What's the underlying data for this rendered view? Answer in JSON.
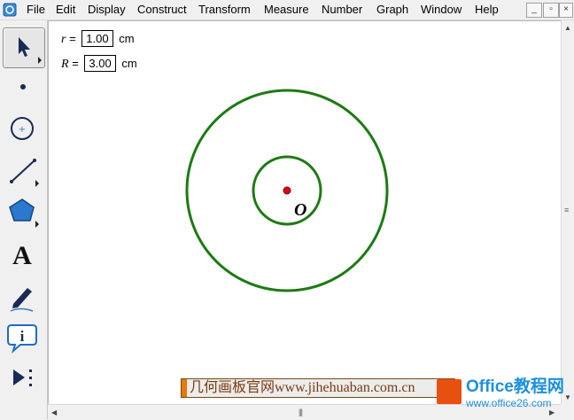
{
  "menubar": {
    "items": [
      {
        "label": "File"
      },
      {
        "label": "Edit"
      },
      {
        "label": "Display"
      },
      {
        "label": "Construct"
      },
      {
        "label": "Transform"
      },
      {
        "label": "Measure"
      },
      {
        "label": "Number"
      },
      {
        "label": "Graph"
      },
      {
        "label": "Window"
      },
      {
        "label": "Help"
      }
    ]
  },
  "window_controls": {
    "minimize": "_",
    "restore": "▫",
    "close": "×"
  },
  "toolbox": {
    "tools": [
      "arrow-select-tool",
      "point-tool",
      "compass-tool",
      "straightedge-tool",
      "polygon-tool",
      "text-tool",
      "marker-tool",
      "information-tool",
      "custom-tools"
    ],
    "text_tool_glyph": "A",
    "info_tool_glyph": "i"
  },
  "parameters": [
    {
      "name": "r",
      "equals": "=",
      "value": "1.00",
      "unit": "cm"
    },
    {
      "name": "R",
      "equals": "=",
      "value": "3.00",
      "unit": "cm"
    }
  ],
  "sketch": {
    "center_label": "O",
    "circle_color": "#1e7a14",
    "center_color": "#e0001a",
    "inner_radius_cm": 1.0,
    "outer_radius_cm": 3.0
  },
  "watermark": {
    "text": "几何画板官网www.jihehuaban.com.cn",
    "logo_title": "Office教程网",
    "logo_url": "www.office26.com"
  }
}
